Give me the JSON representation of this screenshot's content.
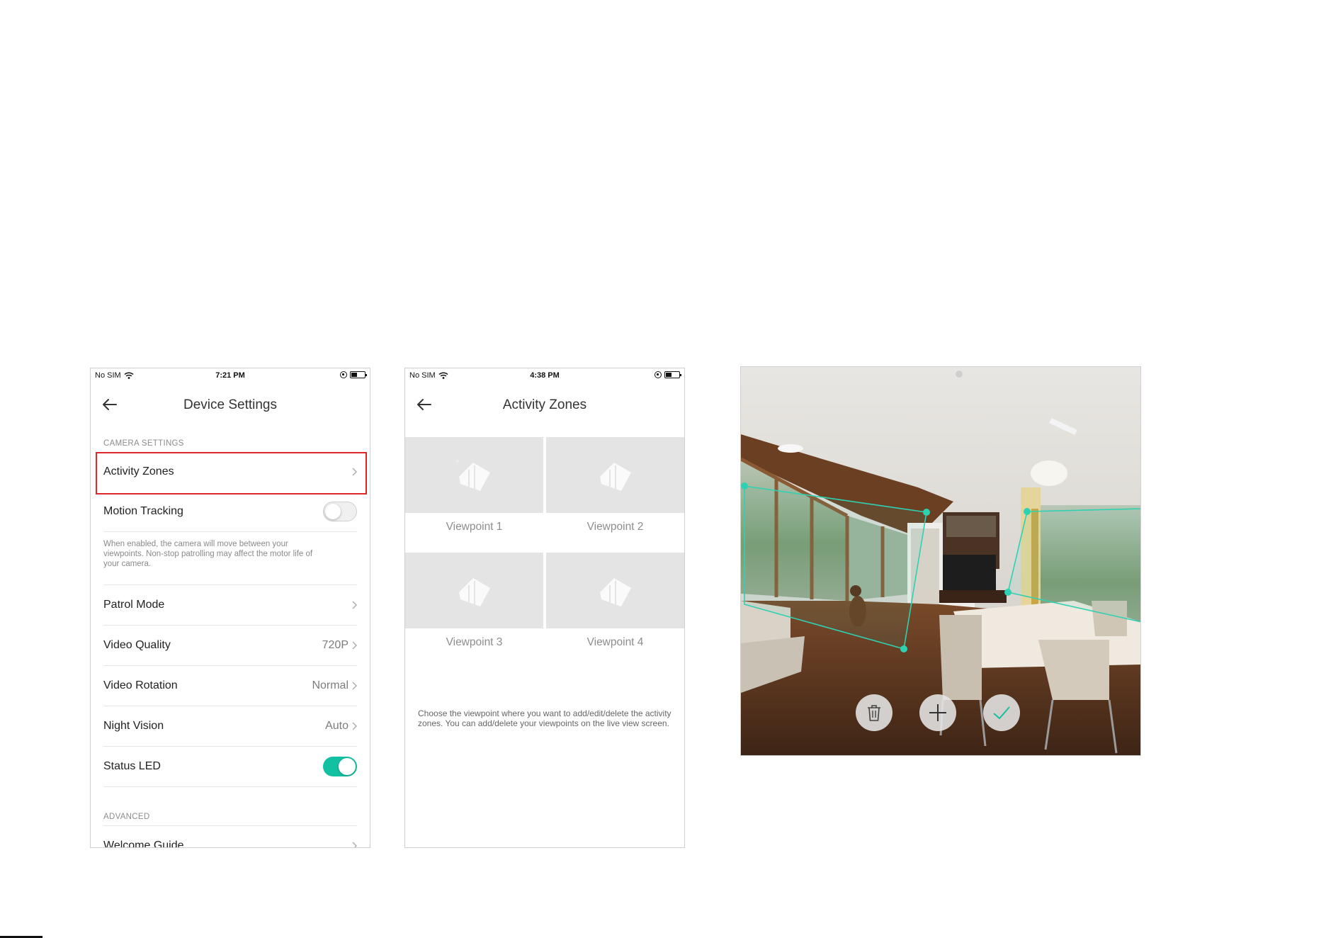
{
  "device_settings": {
    "status": {
      "carrier": "No SIM",
      "time": "7:21 PM"
    },
    "title": "Device Settings",
    "camera_section": "CAMERA SETTINGS",
    "rows": {
      "activity_zones": "Activity Zones",
      "motion_tracking": "Motion Tracking",
      "motion_tracking_desc": "When enabled, the camera will move between your viewpoints. Non-stop patrolling may affect the motor life of your camera.",
      "patrol_mode": "Patrol Mode",
      "video_quality": "Video Quality",
      "video_quality_value": "720P",
      "video_rotation": "Video Rotation",
      "video_rotation_value": "Normal",
      "night_vision": "Night Vision",
      "night_vision_value": "Auto",
      "status_led": "Status LED"
    },
    "toggles": {
      "motion_tracking": false,
      "status_led": true
    },
    "advanced_section": "ADVANCED",
    "welcome_guide": "Welcome Guide"
  },
  "activity_zones": {
    "status": {
      "carrier": "No SIM",
      "time": "4:38 PM"
    },
    "title": "Activity Zones",
    "viewpoints": [
      "Viewpoint 1",
      "Viewpoint 2",
      "Viewpoint 3",
      "Viewpoint 4"
    ],
    "hint": "Choose the viewpoint where you want to add/edit/delete the activity zones. You can add/delete your viewpoints on the live view screen."
  },
  "camera_view": {
    "buttons": [
      "trash-icon",
      "plus-icon",
      "check-icon"
    ]
  },
  "colors": {
    "accent": "#14c0a2",
    "highlight": "#e0262c",
    "zone": "#2fd1b3"
  }
}
